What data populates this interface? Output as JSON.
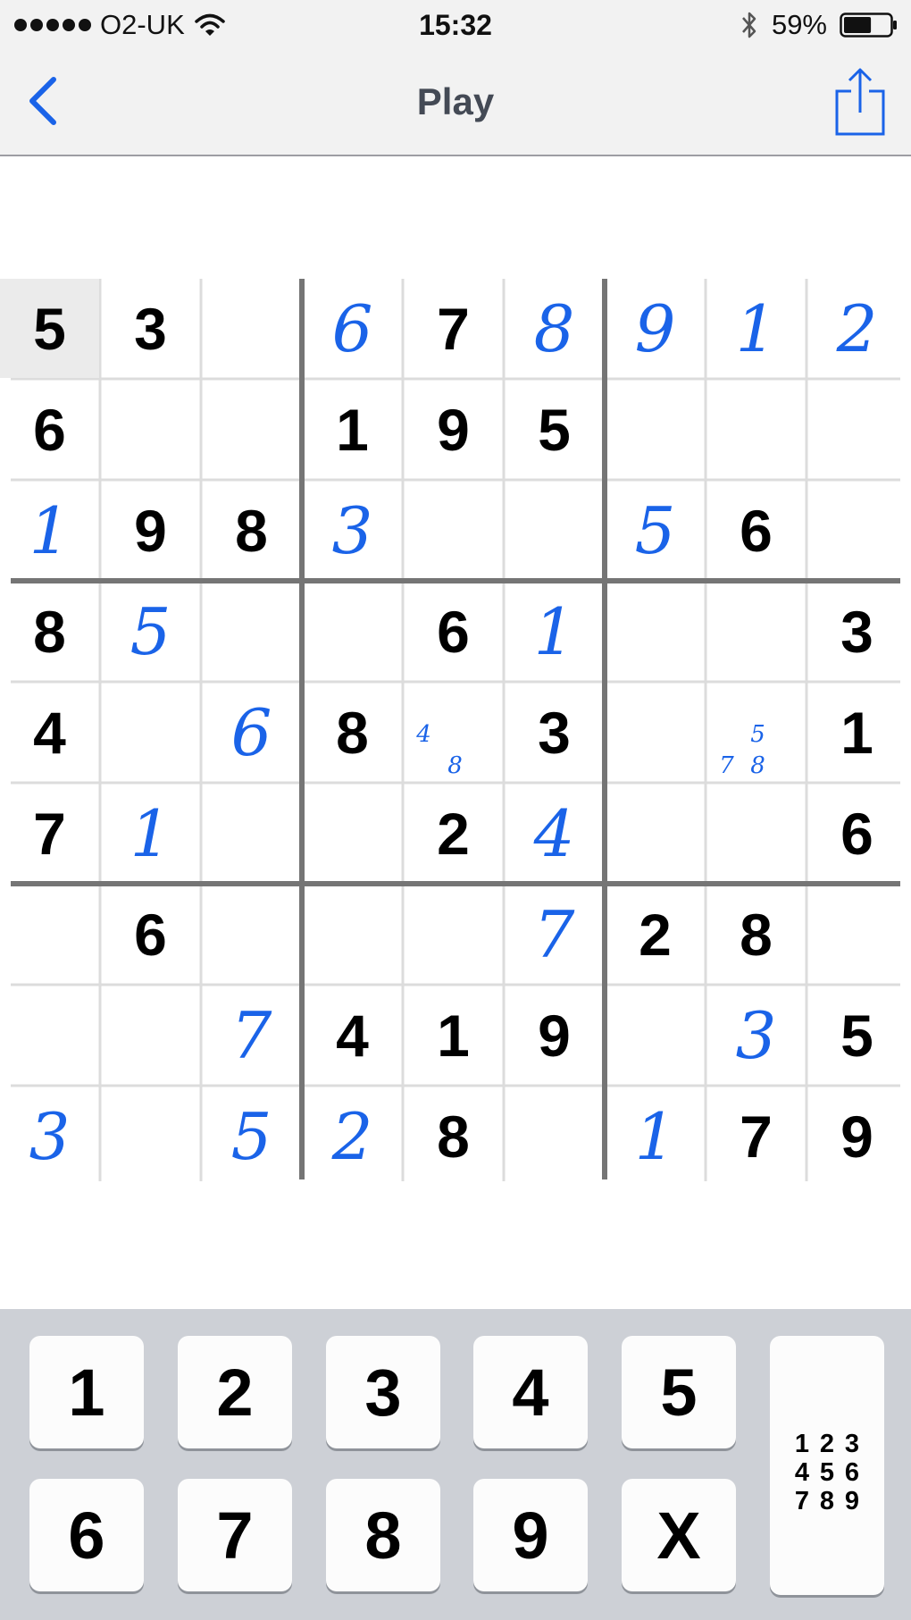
{
  "status_bar": {
    "carrier": "O2-UK",
    "time": "15:32",
    "battery_percent": "59%",
    "battery_level": 0.59
  },
  "nav": {
    "title": "Play",
    "back_icon": "chevron-left-icon",
    "share_icon": "share-icon"
  },
  "board": {
    "selected_cell": [
      0,
      0
    ],
    "rows": [
      [
        "5",
        "3",
        "",
        "6",
        "7",
        "8",
        "9",
        "1",
        "2"
      ],
      [
        "6",
        "",
        "",
        "1",
        "9",
        "5",
        "",
        "",
        ""
      ],
      [
        "1",
        "9",
        "8",
        "3",
        "",
        "",
        "5",
        "6",
        ""
      ],
      [
        "8",
        "5",
        "",
        "",
        "6",
        "1",
        "",
        "",
        "3"
      ],
      [
        "4",
        "",
        "6",
        "8",
        "",
        "3",
        "",
        "",
        "1"
      ],
      [
        "7",
        "1",
        "",
        "",
        "2",
        "4",
        "",
        "",
        "6"
      ],
      [
        "",
        "6",
        "",
        "",
        "",
        "7",
        "2",
        "8",
        ""
      ],
      [
        "",
        "",
        "7",
        "4",
        "1",
        "9",
        "",
        "3",
        "5"
      ],
      [
        "3",
        "",
        "5",
        "2",
        "8",
        "",
        "1",
        "7",
        "9"
      ]
    ],
    "entered_mask": [
      [
        0,
        0,
        0,
        1,
        0,
        1,
        1,
        1,
        1
      ],
      [
        0,
        0,
        0,
        0,
        0,
        0,
        0,
        0,
        0
      ],
      [
        1,
        0,
        0,
        1,
        0,
        0,
        1,
        0,
        0
      ],
      [
        0,
        1,
        0,
        0,
        0,
        1,
        0,
        0,
        0
      ],
      [
        0,
        0,
        1,
        0,
        0,
        0,
        0,
        0,
        0
      ],
      [
        0,
        1,
        0,
        0,
        0,
        1,
        0,
        0,
        0
      ],
      [
        0,
        0,
        0,
        0,
        0,
        1,
        0,
        0,
        0
      ],
      [
        0,
        0,
        1,
        0,
        0,
        0,
        0,
        1,
        0
      ],
      [
        1,
        0,
        1,
        1,
        0,
        0,
        1,
        0,
        0
      ]
    ],
    "pencil_marks": [
      {
        "row": 4,
        "col": 4,
        "digits": [
          "4",
          "8"
        ]
      },
      {
        "row": 4,
        "col": 7,
        "digits": [
          "5",
          "7",
          "8"
        ]
      }
    ]
  },
  "keypad": {
    "keys": [
      "1",
      "2",
      "3",
      "4",
      "5",
      "6",
      "7",
      "8",
      "9",
      "X"
    ],
    "notes_toggle_digits": [
      "1",
      "2",
      "3",
      "4",
      "5",
      "6",
      "7",
      "8",
      "9"
    ]
  },
  "colors": {
    "entered_digit": "#1a63e8",
    "given_digit": "#000000",
    "accent": "#1a63e8",
    "keypad_background": "#cdd0d6"
  }
}
